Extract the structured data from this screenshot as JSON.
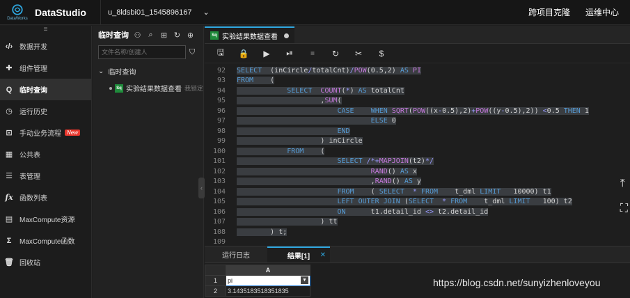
{
  "header": {
    "logo_text": "DataWorks",
    "app_title": "DataStudio",
    "project": "u_8ldsbi01_1545896167",
    "links": [
      "跨项目克隆",
      "运维中心"
    ]
  },
  "nav": {
    "items": [
      {
        "label": "数据开发",
        "icon": "code-icon"
      },
      {
        "label": "组件管理",
        "icon": "puzzle-icon"
      },
      {
        "label": "临时查询",
        "icon": "search-icon",
        "active": true
      },
      {
        "label": "运行历史",
        "icon": "clock-icon"
      },
      {
        "label": "手动业务流程",
        "icon": "workflow-icon",
        "badge": "New"
      },
      {
        "label": "公共表",
        "icon": "table-icon"
      },
      {
        "label": "表管理",
        "icon": "table-manage-icon"
      },
      {
        "label": "函数列表",
        "icon": "function-icon"
      },
      {
        "label": "MaxCompute资源",
        "icon": "resource-icon"
      },
      {
        "label": "MaxCompute函数",
        "icon": "sigma-icon"
      },
      {
        "label": "回收站",
        "icon": "trash-icon"
      }
    ]
  },
  "explorer": {
    "title": "临时查询",
    "search_placeholder": "文件名称/创建人",
    "folder": "临时查询",
    "file_label": "实验结果数据查看",
    "file_owner": "我锁定",
    "file_icon_text": "Sq"
  },
  "editor": {
    "tab_title": "实验结果数据查看",
    "lines": [
      {
        "n": "92",
        "html": "<span class='sel'><span class='kw'>SELECT</span>  (inCircle<span class='op'>/</span>totalCnt)<span class='op'>/</span><span class='fn'>POW</span>(0.5,2) <span class='kw'>AS</span> <span class='fn'>PI</span></span>"
      },
      {
        "n": "93",
        "html": "<span class='sel'><span class='kw'>FROM</span>    (</span>"
      },
      {
        "n": "94",
        "html": "<span class='sel'>            <span class='kw'>SELECT</span>  <span class='fn'>COUNT</span>(<span class='op'>*</span>) <span class='kw'>AS</span> totalCnt</span>"
      },
      {
        "n": "95",
        "html": "<span class='sel'>                    ,<span class='fn'>SUM</span>(</span>"
      },
      {
        "n": "96",
        "html": "<span class='sel'>                        <span class='kw'>CASE</span>    <span class='kw'>WHEN</span> <span class='fn'>SQRT</span>(<span class='fn'>POW</span>((x<span class='op'>-</span>0.5),2)<span class='op'>+</span><span class='fn'>POW</span>((y<span class='op'>-</span>0.5),2)) <span class='op'>&lt;</span>0.5 <span class='kw'>THEN</span> 1</span>"
      },
      {
        "n": "97",
        "html": "<span class='sel'>                                <span class='kw'>ELSE</span> 0</span>"
      },
      {
        "n": "98",
        "html": "<span class='sel'>                        <span class='kw'>END</span></span>"
      },
      {
        "n": "99",
        "html": "<span class='sel'>                    ) inCircle</span>"
      },
      {
        "n": "100",
        "html": "<span class='sel'>            <span class='kw'>FROM</span>    (</span>"
      },
      {
        "n": "101",
        "html": "<span class='sel'>                        <span class='kw'>SELECT</span> <span class='op'>/*+</span><span class='fn'>MAPJOIN</span>(t2)<span class='op'>*/</span></span>"
      },
      {
        "n": "102",
        "html": "<span class='sel'>                                <span class='fn'>RAND</span>() <span class='kw'>AS</span> x</span>"
      },
      {
        "n": "103",
        "html": "<span class='sel'>                                ,<span class='fn'>RAND</span>() <span class='kw'>AS</span> y</span>"
      },
      {
        "n": "104",
        "html": "<span class='sel'>                        <span class='kw'>FROM</span>    ( <span class='kw'>SELECT</span>  <span class='op'>*</span> <span class='kw'>FROM</span>    t_dml <span class='kw'>LIMIT</span>   10000) t1</span>"
      },
      {
        "n": "105",
        "html": "<span class='sel'>                        <span class='kw'>LEFT OUTER JOIN</span> (<span class='kw'>SELECT</span>  <span class='op'>*</span> <span class='kw'>FROM</span>    t_dml <span class='kw'>LIMIT</span>   100) t2</span>"
      },
      {
        "n": "106",
        "html": "<span class='sel'>                        <span class='kw'>ON</span>      t1.detail_id <span class='op'>&lt;&gt;</span> t2.detail_id</span>"
      },
      {
        "n": "107",
        "html": "<span class='sel'>                    ) tt</span>"
      },
      {
        "n": "108",
        "html": "<span class='sel'>        ) t;</span>"
      },
      {
        "n": "109",
        "html": ""
      }
    ]
  },
  "results": {
    "tabs": [
      "运行日志",
      "结果[1]"
    ],
    "column_header": "A",
    "row_numbers": [
      "1",
      "2"
    ],
    "header_cell": "pi",
    "value": "3.1435183518351835"
  },
  "watermark": "https://blog.csdn.net/sunyizhenloveyou"
}
